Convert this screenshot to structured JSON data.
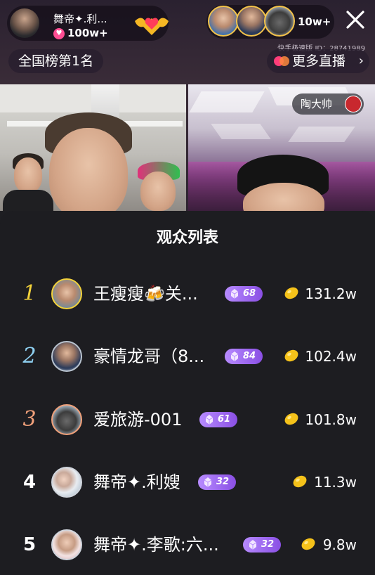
{
  "host": {
    "name": "舞帝✦.利...",
    "likes": "100w+"
  },
  "viewers": {
    "count": "10w+"
  },
  "live_id": "快手极速版 ID：28741989",
  "rank_badge": "全国榜第1名",
  "more_live": {
    "label": "更多直播",
    "chevron": "›"
  },
  "streamer_tag": "陶大帅",
  "sheet": {
    "title": "观众列表"
  },
  "audience": [
    {
      "rank": "1",
      "name": "王瘦瘦🍻关...",
      "level": "68",
      "coins": "131.2w"
    },
    {
      "rank": "2",
      "name": "豪情龙哥（8...",
      "level": "84",
      "coins": "102.4w"
    },
    {
      "rank": "3",
      "name": "爱旅游-001",
      "level": "61",
      "coins": "101.8w"
    },
    {
      "rank": "4",
      "name": "舞帝✦.利嫂",
      "level": "32",
      "coins": "11.3w"
    },
    {
      "rank": "5",
      "name": "舞帝✦.李歌:六...",
      "level": "32",
      "coins": "9.8w"
    }
  ],
  "colors": {
    "rank1": "#f3d23a",
    "rank2": "#8ecff0",
    "rank3": "#f0a07a",
    "coin": "#f5c21a",
    "level_badge": "#9a5cf0"
  }
}
